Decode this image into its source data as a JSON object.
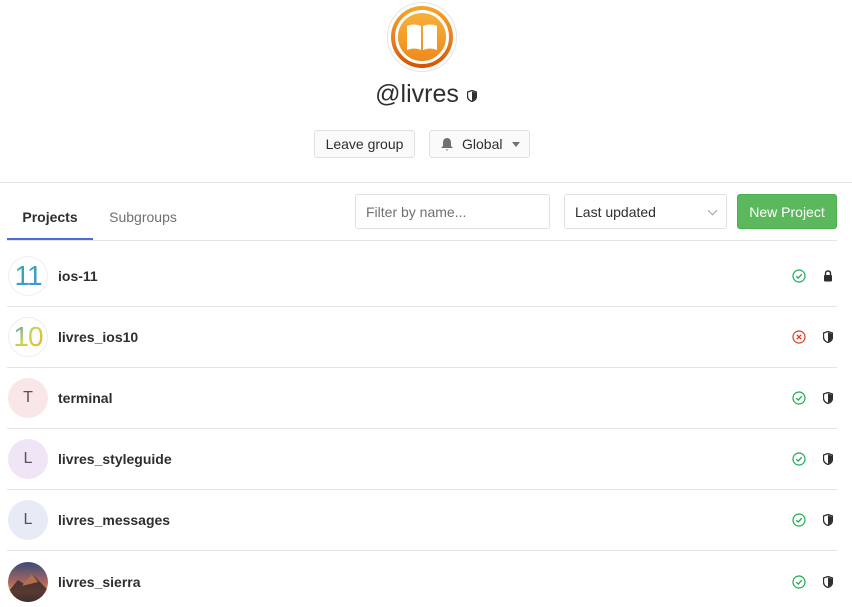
{
  "group": {
    "handle": "@livres",
    "leave_label": "Leave group",
    "notification_label": "Global"
  },
  "tabs": {
    "projects": "Projects",
    "subgroups": "Subgroups"
  },
  "filter": {
    "placeholder": "Filter by name..."
  },
  "sort": {
    "selected": "Last updated"
  },
  "new_project_label": "New Project",
  "projects": [
    {
      "name": "ios-11",
      "avatar": "11",
      "avatar_type": "image",
      "status": "success",
      "visibility": "private"
    },
    {
      "name": "livres_ios10",
      "avatar": "10",
      "avatar_type": "image",
      "status": "failed",
      "visibility": "internal"
    },
    {
      "name": "terminal",
      "avatar": "T",
      "avatar_type": "letter",
      "avatar_bg": "#f8e7e6",
      "status": "success",
      "visibility": "internal"
    },
    {
      "name": "livres_styleguide",
      "avatar": "L",
      "avatar_type": "letter",
      "avatar_bg": "#f0e5f7",
      "status": "success",
      "visibility": "internal"
    },
    {
      "name": "livres_messages",
      "avatar": "L",
      "avatar_type": "letter",
      "avatar_bg": "#e8eaf6",
      "status": "success",
      "visibility": "internal"
    },
    {
      "name": "livres_sierra",
      "avatar": "",
      "avatar_type": "image",
      "status": "success",
      "visibility": "internal"
    }
  ],
  "colors": {
    "success": "#1aaa55",
    "failed": "#db3b21",
    "primary_button": "#5cb85c",
    "tab_underline": "#4b6cd1"
  }
}
